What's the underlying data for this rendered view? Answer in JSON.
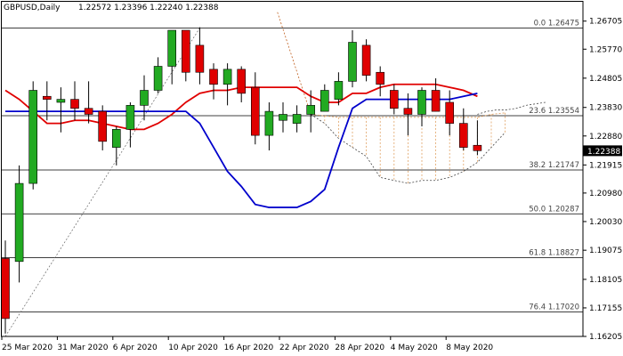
{
  "chart_data": {
    "type": "candlestick",
    "title": "GBPUSD,Daily",
    "ohlc_text": "1.22572 1.23396 1.22240 1.22388",
    "last_price": "1.22388",
    "ylim": [
      1.16205,
      1.2723
    ],
    "y_ticks": [
      "1.26705",
      "1.25770",
      "1.24805",
      "1.23830",
      "1.22880",
      "1.21915",
      "1.20980",
      "1.20030",
      "1.19075",
      "1.18105",
      "1.17155",
      "1.16205"
    ],
    "x_ticks": [
      {
        "i": 0,
        "label": "25 Mar 2020"
      },
      {
        "i": 4,
        "label": "31 Mar 2020"
      },
      {
        "i": 8,
        "label": "6 Apr 2020"
      },
      {
        "i": 12,
        "label": "10 Apr 2020"
      },
      {
        "i": 16,
        "label": "16 Apr 2020"
      },
      {
        "i": 20,
        "label": "22 Apr 2020"
      },
      {
        "i": 24,
        "label": "28 Apr 2020"
      },
      {
        "i": 28,
        "label": "4 May 2020"
      },
      {
        "i": 32,
        "label": "8 May 2020"
      }
    ],
    "fib_levels": [
      {
        "label": "0.0 1.26475",
        "value": 1.26475
      },
      {
        "label": "23.6 1.23554",
        "value": 1.23554
      },
      {
        "label": "38.2 1.21747",
        "value": 1.21747
      },
      {
        "label": "50.0 1.20287",
        "value": 1.20287
      },
      {
        "label": "61.8 1.18827",
        "value": 1.18827
      },
      {
        "label": "76.4 1.17020",
        "value": 1.1702
      }
    ],
    "candles": [
      [
        1.188,
        1.194,
        1.163,
        1.168
      ],
      [
        1.187,
        1.219,
        1.18,
        1.213
      ],
      [
        1.213,
        1.247,
        1.211,
        1.244
      ],
      [
        1.242,
        1.247,
        1.234,
        1.241
      ],
      [
        1.24,
        1.245,
        1.23,
        1.241
      ],
      [
        1.241,
        1.247,
        1.234,
        1.238
      ],
      [
        1.238,
        1.247,
        1.233,
        1.236
      ],
      [
        1.237,
        1.239,
        1.224,
        1.227
      ],
      [
        1.225,
        1.232,
        1.219,
        1.231
      ],
      [
        1.231,
        1.24,
        1.225,
        1.239
      ],
      [
        1.239,
        1.249,
        1.234,
        1.244
      ],
      [
        1.244,
        1.255,
        1.243,
        1.252
      ],
      [
        1.252,
        1.26,
        1.246,
        1.264
      ],
      [
        1.264,
        1.26,
        1.247,
        1.25
      ],
      [
        1.259,
        1.265,
        1.246,
        1.25
      ],
      [
        1.251,
        1.253,
        1.241,
        1.246
      ],
      [
        1.246,
        1.253,
        1.239,
        1.251
      ],
      [
        1.251,
        1.252,
        1.24,
        1.243
      ],
      [
        1.245,
        1.25,
        1.226,
        1.229
      ],
      [
        1.229,
        1.24,
        1.224,
        1.237
      ],
      [
        1.234,
        1.24,
        1.23,
        1.236
      ],
      [
        1.233,
        1.239,
        1.23,
        1.236
      ],
      [
        1.236,
        1.244,
        1.23,
        1.239
      ],
      [
        1.237,
        1.246,
        1.237,
        1.244
      ],
      [
        1.241,
        1.25,
        1.239,
        1.247
      ],
      [
        1.247,
        1.264,
        1.245,
        1.26
      ],
      [
        1.259,
        1.261,
        1.247,
        1.249
      ],
      [
        1.25,
        1.252,
        1.242,
        1.246
      ],
      [
        1.244,
        1.246,
        1.236,
        1.238
      ],
      [
        1.238,
        1.243,
        1.229,
        1.236
      ],
      [
        1.236,
        1.245,
        1.232,
        1.244
      ],
      [
        1.244,
        1.248,
        1.237,
        1.237
      ],
      [
        1.24,
        1.244,
        1.229,
        1.233
      ],
      [
        1.233,
        1.238,
        1.224,
        1.225
      ],
      [
        1.2257,
        1.234,
        1.2224,
        1.2239
      ]
    ],
    "series": [
      {
        "color": "#e00000",
        "values": [
          1.244,
          1.241,
          1.237,
          1.233,
          1.233,
          1.234,
          1.234,
          1.233,
          1.232,
          1.231,
          1.231,
          1.233,
          1.236,
          1.24,
          1.243,
          1.244,
          1.244,
          1.245,
          1.245,
          1.245,
          1.245,
          1.245,
          1.242,
          1.24,
          1.24,
          1.243,
          1.243,
          1.245,
          1.246,
          1.246,
          1.246,
          1.246,
          1.245,
          1.244,
          1.242
        ]
      },
      {
        "color": "#0000cc",
        "values": [
          1.237,
          1.237,
          1.237,
          1.237,
          1.237,
          1.237,
          1.237,
          1.237,
          1.237,
          1.237,
          1.237,
          1.237,
          1.237,
          1.237,
          1.233,
          1.225,
          1.217,
          1.212,
          1.206,
          1.205,
          1.205,
          1.205,
          1.207,
          1.211,
          1.225,
          1.238,
          1.241,
          1.241,
          1.241,
          1.241,
          1.241,
          1.241,
          1.241,
          1.242,
          1.243
        ]
      }
    ],
    "cloud_span_a": [
      1.236,
      1.2355,
      1.235,
      1.235,
      1.235,
      1.235,
      1.235,
      1.235,
      1.235,
      1.235,
      1.235,
      1.235,
      1.235,
      1.236,
      1.2365
    ],
    "cloud_span_b": [
      1.236,
      1.233,
      1.228,
      1.225,
      1.222,
      1.215,
      1.214,
      1.213,
      1.214,
      1.214,
      1.215,
      1.217,
      1.22,
      1.225,
      1.23
    ],
    "lagging_span": [
      1.168,
      1.19,
      1.205,
      1.225,
      1.228,
      1.232,
      1.235,
      1.236,
      1.239,
      1.24,
      1.242,
      1.244,
      1.25,
      1.254,
      1.262,
      1.266
    ],
    "forward_span": [
      1.236,
      1.237,
      1.2375,
      1.2375,
      1.238,
      1.239,
      1.2395,
      1.24
    ],
    "colors": {
      "bull": "#22aa22",
      "bear": "#e00000",
      "grid": "#000000",
      "cloud": "#e0a060",
      "last_bg": "#000000"
    }
  }
}
